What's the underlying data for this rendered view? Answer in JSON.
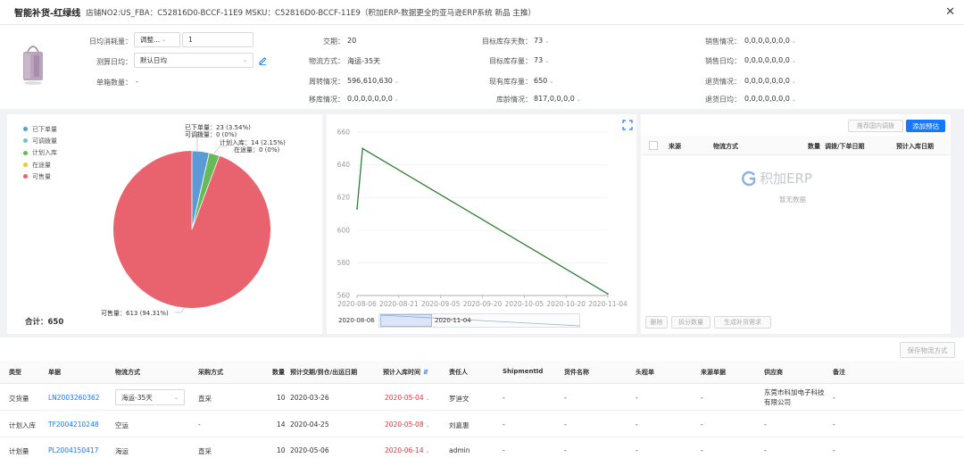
{
  "window": {
    "title": "智能补货-红绿线",
    "subtitle": "店铺NO2:US_FBA：C52816D0-BCCF-11E9  MSKU：C52816D0-BCCF-11E9（积加ERP-数据更全的亚马逊ERP系统  新品 主推）"
  },
  "info": {
    "daily_label": "日均消耗量：",
    "daily_adjust": "调整...",
    "daily_value": "1",
    "calc_label": "测算日均：",
    "calc_value": "默认日均",
    "box_label": "单箱数量：",
    "box_value": "-",
    "delivery_label": "交期：",
    "delivery_value": "20",
    "shipping_label": "物流方式：",
    "shipping_value": "海运-35天",
    "turnover_label": "周转情况：",
    "turnover_value": "596,610,630",
    "transfer_label": "移库情况：",
    "transfer_value": "0,0,0,0,0,0,0",
    "target_days_label": "目标库存天数：",
    "target_days_value": "73",
    "target_stock_label": "目标库存量：",
    "target_stock_value": "73",
    "current_stock_label": "现有库存量：",
    "current_stock_value": "650",
    "age_label": "库龄情况：",
    "age_value": "817,0,0,0,0",
    "sales_label": "销售情况：",
    "sales_value": "0,0,0,0,0,0,0",
    "sales_avg_label": "销售日均：",
    "sales_avg_value": "0,0,0,0,0,0,0",
    "return_label": "退货情况：",
    "return_value": "0,0,0,0,0,0,0",
    "return_avg_label": "退货日均：",
    "return_avg_value": "0,0,0,0,0,0,0"
  },
  "pie": {
    "legend": [
      "已下单量",
      "可调拨量",
      "计划入库",
      "在途量",
      "可售量"
    ],
    "colors": [
      "#5b9bd5",
      "#70c3c8",
      "#67b95a",
      "#f3c345",
      "#e8636e"
    ],
    "labels": [
      "已下单量：23 (3.54%)",
      "可调拨量：0 (0%)",
      "计划入库：14 (2.15%)",
      "在途量：0 (0%)",
      "可售量：613 (94.31%)"
    ],
    "total_label": "合计：",
    "total_value": "650"
  },
  "chart_data": {
    "type": "line",
    "x": [
      "2020-08-06",
      "2020-08-08",
      "2020-11-04"
    ],
    "y": [
      613,
      650,
      561
    ],
    "xticks": [
      "2020-08-06",
      "2020-08-21",
      "2020-09-05",
      "2020-09-20",
      "2020-10-05",
      "2020-10-20",
      "2020-11-04"
    ],
    "yticks": [
      "560",
      "580",
      "600",
      "620",
      "640",
      "660"
    ],
    "ylim": [
      560,
      660
    ],
    "color": "#2e7d32",
    "range_start": "2020-08-06",
    "range_end": "2020-11-04"
  },
  "right_panel": {
    "btn_domestic": "推荐国内调拨",
    "btn_add": "添加预估",
    "cols": [
      "来源",
      "物流方式",
      "数量",
      "调拨/下单日期",
      "预计入库日期"
    ],
    "brand": "积加ERP",
    "empty": "暂无数据",
    "btn_delete": "删除",
    "btn_split": "拆分数量",
    "btn_generate": "生成补货需求"
  },
  "save_label": "保存物流方式",
  "table": {
    "headers": [
      "类型",
      "单据",
      "物流方式",
      "采购方式",
      "数量",
      "预计交期/到仓/出运日期",
      "预计入库时间",
      "责任人",
      "ShipmentId",
      "货件名称",
      "头程单",
      "来源单据",
      "供应商",
      "备注"
    ],
    "rows": [
      {
        "type": "交货量",
        "doc": "LN2003260362",
        "ship": "海运-35天",
        "buy": "直采",
        "qty": "10",
        "date": "2020-03-26",
        "arrive": "2020-05-04",
        "owner": "罗迪文",
        "sid": "-",
        "sname": "-",
        "head": "-",
        "src": "-",
        "supplier": "东莞市科加电子科技有限公司",
        "note": "-"
      },
      {
        "type": "计划入库",
        "doc": "TF2004210248",
        "ship": "空运",
        "buy": "-",
        "qty": "14",
        "date": "2020-04-25",
        "arrive": "2020-05-08",
        "owner": "刘嘉惠",
        "sid": "-",
        "sname": "-",
        "head": "-",
        "src": "-",
        "supplier": "-",
        "note": "-"
      },
      {
        "type": "计划量",
        "doc": "PL2004150417",
        "ship": "海运",
        "buy": "直采",
        "qty": "10",
        "date": "2020-05-06",
        "arrive": "2020-06-14",
        "owner": "admin",
        "sid": "-",
        "sname": "-",
        "head": "-",
        "src": "-",
        "supplier": "-",
        "note": "-"
      }
    ]
  }
}
